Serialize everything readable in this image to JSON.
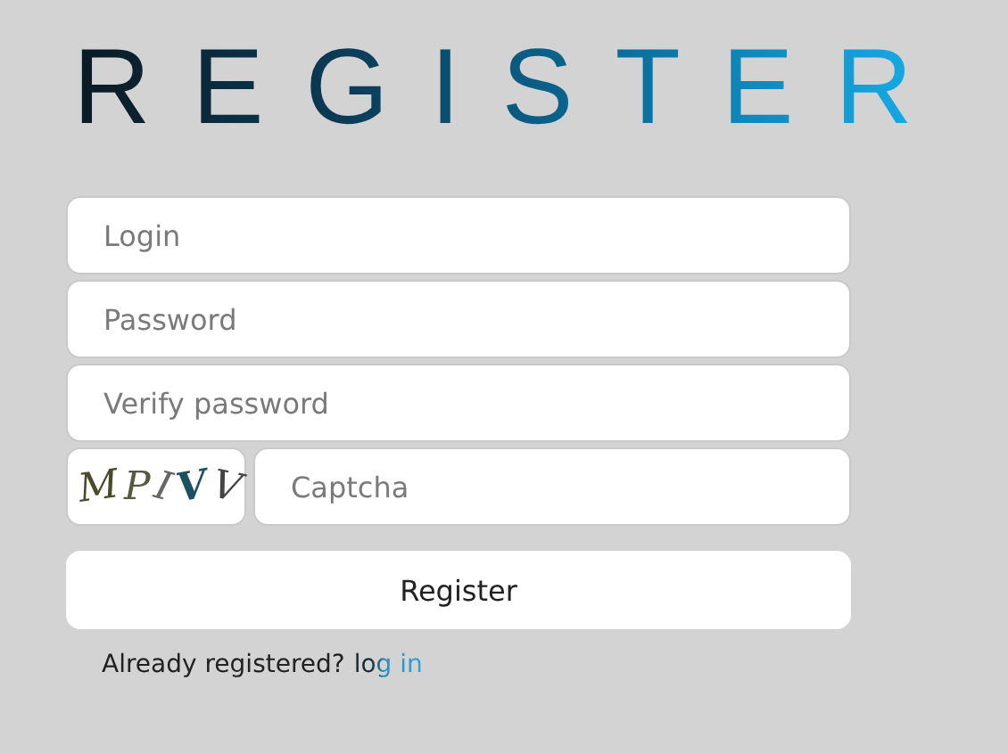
{
  "title": "REGISTER",
  "fields": [
    {
      "placeholder": "Login"
    },
    {
      "placeholder": "Password"
    },
    {
      "placeholder": "Verify password"
    }
  ],
  "captcha": {
    "code": "MPIVV",
    "placeholder": "Captcha"
  },
  "submit_button": "Register",
  "footer": {
    "text": "Already registered?",
    "link": "log in"
  }
}
